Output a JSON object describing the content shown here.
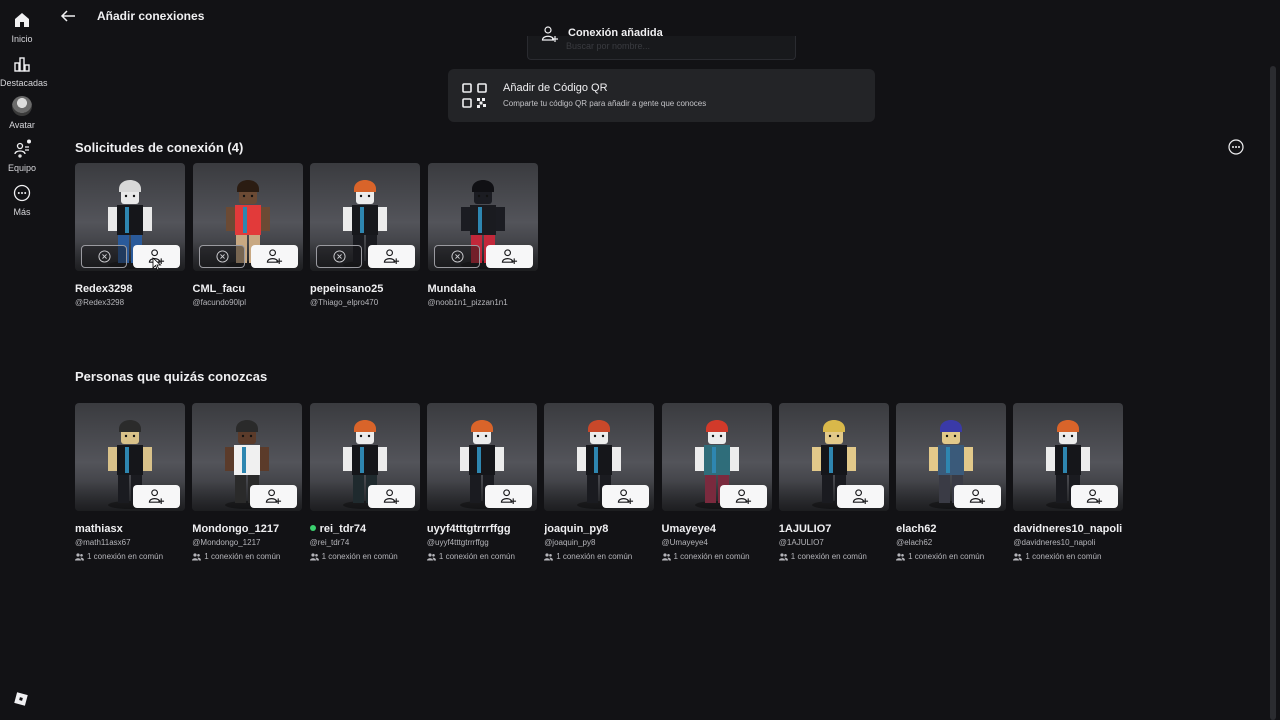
{
  "sidebar": {
    "items": [
      {
        "label": "Inicio",
        "icon": "home-icon"
      },
      {
        "label": "Destacadas",
        "icon": "charts-icon"
      },
      {
        "label": "Avatar",
        "icon": "avatar-icon"
      },
      {
        "label": "Equipo",
        "icon": "party-icon"
      },
      {
        "label": "Más",
        "icon": "more-icon"
      }
    ]
  },
  "header": {
    "title": "Añadir conexiones"
  },
  "toast": {
    "text": "Conexión añadida",
    "search_placeholder": "Buscar por nombre..."
  },
  "qr": {
    "title": "Añadir de Código QR",
    "subtitle": "Comparte tu código QR para añadir a gente que conoces"
  },
  "requests": {
    "title": "Solicitudes de conexión (4)",
    "items": [
      {
        "name": "Redex3298",
        "handle": "@Redex3298"
      },
      {
        "name": "CML_facu",
        "handle": "@facundo90lpl"
      },
      {
        "name": "pepeinsano25",
        "handle": "@Thiago_elpro470"
      },
      {
        "name": "Mundaha",
        "handle": "@noob1n1_pizzan1n1"
      }
    ]
  },
  "suggestions": {
    "title": "Personas que quizás conozcas",
    "items": [
      {
        "name": "mathiasx",
        "handle": "@math11asx67",
        "mutual": "1 conexión en común"
      },
      {
        "name": "Mondongo_1217",
        "handle": "@Mondongo_1217",
        "mutual": "1 conexión en común"
      },
      {
        "name": "rei_tdr74",
        "handle": "@rei_tdr74",
        "mutual": "1 conexión en común",
        "online": true
      },
      {
        "name": "uyyf4tttgtrrrffgg",
        "handle": "@uyyf4tttgtrrrffgg",
        "mutual": "1 conexión en común"
      },
      {
        "name": "joaquin_py8",
        "handle": "@joaquin_py8",
        "mutual": "1 conexión en común"
      },
      {
        "name": "Umayeye4",
        "handle": "@Umayeye4",
        "mutual": "1 conexión en común"
      },
      {
        "name": "1AJULIO7",
        "handle": "@1AJULIO7",
        "mutual": "1 conexión en común"
      },
      {
        "name": "elach62",
        "handle": "@elach62",
        "mutual": "1 conexión en común"
      },
      {
        "name": "davidneres10_napoli",
        "handle": "@davidneres10_napoli",
        "mutual": "1 conexión en común"
      }
    ]
  },
  "colors": {
    "background": "#121215",
    "card": "#232427",
    "online": "#3bd16f"
  }
}
